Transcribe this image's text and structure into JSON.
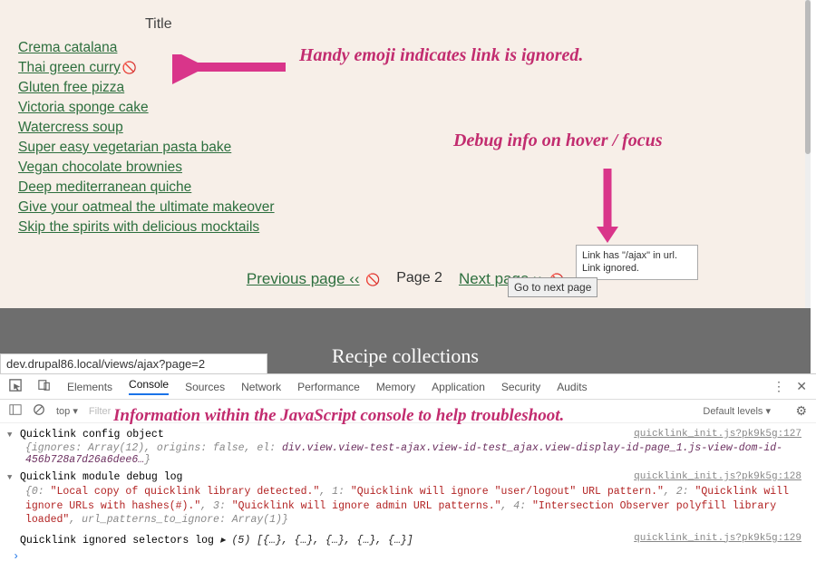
{
  "header": {
    "title_label": "Title"
  },
  "recipes": [
    {
      "label": "Crema catalana",
      "ignored": false
    },
    {
      "label": "Thai green curry",
      "ignored": true
    },
    {
      "label": "Gluten free pizza",
      "ignored": false
    },
    {
      "label": "Victoria sponge cake",
      "ignored": false
    },
    {
      "label": "Watercress soup",
      "ignored": false
    },
    {
      "label": "Super easy vegetarian pasta bake",
      "ignored": false
    },
    {
      "label": "Vegan chocolate brownies",
      "ignored": false
    },
    {
      "label": "Deep mediterranean quiche",
      "ignored": false
    },
    {
      "label": "Give your oatmeal the ultimate makeover",
      "ignored": false
    },
    {
      "label": "Skip the spirits with delicious mocktails",
      "ignored": false
    }
  ],
  "annotations": {
    "a1": "Handy emoji indicates link is ignored.",
    "a2": "Debug info on hover / focus",
    "a3": "Information within the JavaScript console to help troubleshoot."
  },
  "pager": {
    "prev": "Previous page ‹‹",
    "current": "Page 2",
    "next": "Next page ››",
    "go_btn": "Go to next page"
  },
  "tooltip": {
    "line1": "Link has \"/ajax\" in url.",
    "line2": "Link ignored."
  },
  "grey_band": {
    "title": "Recipe collections"
  },
  "url_bar": "dev.drupal86.local/views/ajax?page=2",
  "devtools": {
    "tabs": [
      "Elements",
      "Console",
      "Sources",
      "Network",
      "Performance",
      "Memory",
      "Application",
      "Security",
      "Audits"
    ],
    "active_tab": "Console",
    "toolbar": {
      "context": "top",
      "filter_placeholder": "Filter",
      "levels": "Default levels"
    },
    "logs": {
      "l1_title": "Quicklink config object",
      "l1_src": "quicklink_init.js?pk9k5g:127",
      "l1_body_pre": "{ignores: Array(12), origins: false, el:",
      "l1_body_em": "div.view.view-test-ajax.view-id-test_ajax.view-display-id-page_1.js-view-dom-id-456b728a7d26a6dee6…",
      "l1_body_post": "}",
      "l2_title": "Quicklink module debug log",
      "l2_src": "quicklink_init.js?pk9k5g:128",
      "l2_0k": "{0: ",
      "l2_0v": "\"Local copy of quicklink library detected.\"",
      "l2_1k": ", 1: ",
      "l2_1v": "\"Quicklink will ignore \"user/logout\" URL pattern.\"",
      "l2_2k": ", 2: ",
      "l2_2v": "\"Quicklink will ignore URLs with hashes(#).\"",
      "l2_3k": ", 3: ",
      "l2_3v": "\"Quicklink will ignore admin URL patterns.\"",
      "l2_4k": ", 4: ",
      "l2_4v": "\"Intersection Observer polyfill library loaded\"",
      "l2_tail": ", url_patterns_to_ignore: Array(1)}",
      "l3_title": "Quicklink ignored selectors log",
      "l3_src": "quicklink_init.js?pk9k5g:129",
      "l3_body": "▸ (5) [{…}, {…}, {…}, {…}, {…}]"
    }
  },
  "icons": {
    "no_entry": "🚫"
  }
}
